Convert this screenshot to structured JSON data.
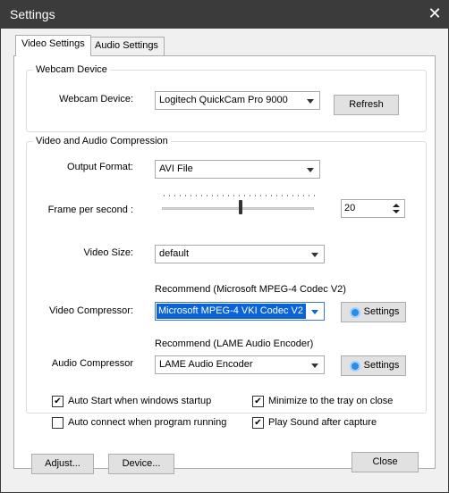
{
  "window": {
    "title": "Settings",
    "close_glyph": "✕"
  },
  "tabs": [
    {
      "label": "Video Settings",
      "active": true
    },
    {
      "label": "Audio Settings",
      "active": false
    }
  ],
  "webcam_group": {
    "legend": "Webcam Device",
    "device_label": "Webcam Device:",
    "device_value": "Logitech QuickCam Pro 9000",
    "refresh_label": "Refresh"
  },
  "compression_group": {
    "legend": "Video and Audio Compression",
    "output_format_label": "Output Format:",
    "output_format_value": "AVI File",
    "fps_label": "Frame per second :",
    "fps_value": "20",
    "fps_slider_level": 0.52,
    "video_size_label": "Video Size:",
    "video_size_value": "default",
    "video_recommend": "Recommend (Microsoft MPEG-4 Codec V2)",
    "video_compressor_label": "Video Compressor:",
    "video_compressor_value": "Microsoft MPEG-4  VKI  Codec V2",
    "video_settings_label": "Settings",
    "audio_recommend": "Recommend (LAME Audio Encoder)",
    "audio_compressor_label": "Audio Compressor",
    "audio_compressor_value": "LAME Audio Encoder",
    "audio_settings_label": "Settings"
  },
  "options": [
    {
      "label": "Auto Start when windows startup",
      "checked": true
    },
    {
      "label": "Minimize to the tray on close",
      "checked": true
    },
    {
      "label": "Auto connect when program running",
      "checked": false
    },
    {
      "label": "Play Sound after capture",
      "checked": true
    }
  ],
  "footer": {
    "adjust_label": "Adjust...",
    "device_label": "Device...",
    "close_label": "Close"
  },
  "colors": {
    "accent": "#0a64d8",
    "titlebar": "#3b3b3b"
  },
  "icons": {
    "settings": "gear-icon",
    "dropdown": "chevron-down-icon",
    "close": "close-icon"
  }
}
